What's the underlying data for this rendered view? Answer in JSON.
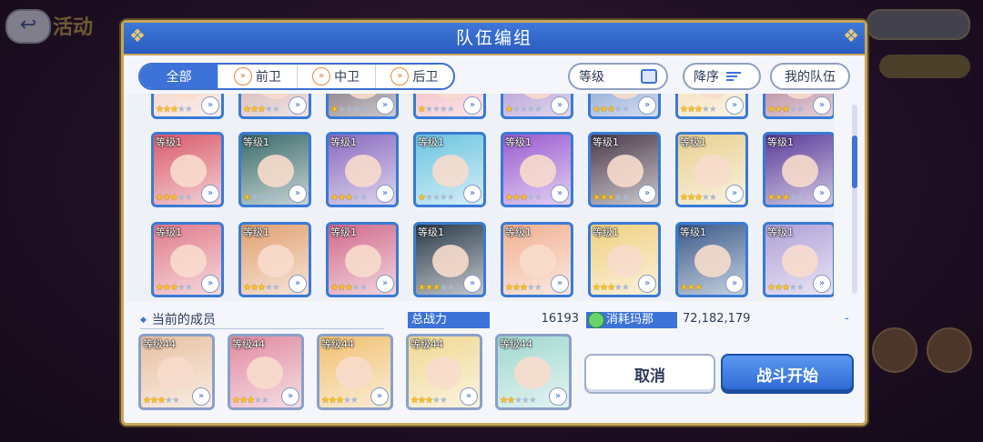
{
  "background": {
    "back_label": "↩",
    "title": "活动"
  },
  "dialog": {
    "title": "队伍编组"
  },
  "filters": {
    "tabs": [
      {
        "label": "全部",
        "active": true
      },
      {
        "label": "前卫",
        "active": false
      },
      {
        "label": "中卫",
        "active": false
      },
      {
        "label": "后卫",
        "active": false
      }
    ]
  },
  "sort": {
    "level_label": "等级",
    "order_label": "降序",
    "my_team_label": "我的队伍"
  },
  "icons": {
    "position_chevron": "»",
    "star": "★"
  },
  "characters": {
    "partial_row": [
      {
        "stars": 3,
        "color": "#f0c7b5"
      },
      {
        "stars": 3,
        "color": "#c9a0a0"
      },
      {
        "stars": 1,
        "color": "#5a4a55"
      },
      {
        "stars": 1,
        "color": "#f1a7b1"
      },
      {
        "stars": 1,
        "color": "#9a7ac8"
      },
      {
        "stars": 3,
        "color": "#6a8ac8"
      },
      {
        "stars": 3,
        "color": "#f1d7a2"
      },
      {
        "stars": 3,
        "color": "#a06080"
      }
    ],
    "row1": [
      {
        "level": "等级1",
        "stars": 3,
        "color": "#d85a6a"
      },
      {
        "level": "等级1",
        "stars": 1,
        "color": "#3a6a6a"
      },
      {
        "level": "等级1",
        "stars": 3,
        "color": "#8a6ac0"
      },
      {
        "level": "等级1",
        "stars": 1,
        "color": "#6ac4e0"
      },
      {
        "level": "等级1",
        "stars": 3,
        "color": "#9a5ad0"
      },
      {
        "level": "等级1",
        "stars": 3,
        "color": "#4a3a4a"
      },
      {
        "level": "等级1",
        "stars": 3,
        "color": "#e8d090"
      },
      {
        "level": "等级1",
        "stars": 3,
        "color": "#5a3a9a"
      }
    ],
    "row2": [
      {
        "level": "等级1",
        "stars": 3,
        "color": "#e07a8a"
      },
      {
        "level": "等级1",
        "stars": 3,
        "color": "#e0a070"
      },
      {
        "level": "等级1",
        "stars": 3,
        "color": "#d06a8a"
      },
      {
        "level": "等级1",
        "stars": 3,
        "color": "#2a3a4a"
      },
      {
        "level": "等级1",
        "stars": 3,
        "color": "#f0b090"
      },
      {
        "level": "等级1",
        "stars": 3,
        "color": "#f0d080"
      },
      {
        "level": "等级1",
        "stars": 3,
        "color": "#3a5a8a"
      },
      {
        "level": "等级1",
        "stars": 3,
        "color": "#b0a0d8"
      }
    ]
  },
  "members": {
    "label": "当前的成员",
    "list": [
      {
        "level": "等级44",
        "stars": 3,
        "color": "#e8c0a0"
      },
      {
        "level": "等级44",
        "stars": 3,
        "color": "#e08aa0"
      },
      {
        "level": "等级44",
        "stars": 3,
        "color": "#f0c070"
      },
      {
        "level": "等级44",
        "stars": 3,
        "color": "#f0d890"
      },
      {
        "level": "等级44",
        "stars": 2,
        "color": "#a0d8d0"
      }
    ]
  },
  "stats": {
    "power_label": "总战力",
    "power_value": "16193",
    "mana_label": "消耗玛那",
    "mana_value": "72,182,179",
    "dash": "-"
  },
  "actions": {
    "cancel_label": "取消",
    "start_label": "战斗开始"
  }
}
